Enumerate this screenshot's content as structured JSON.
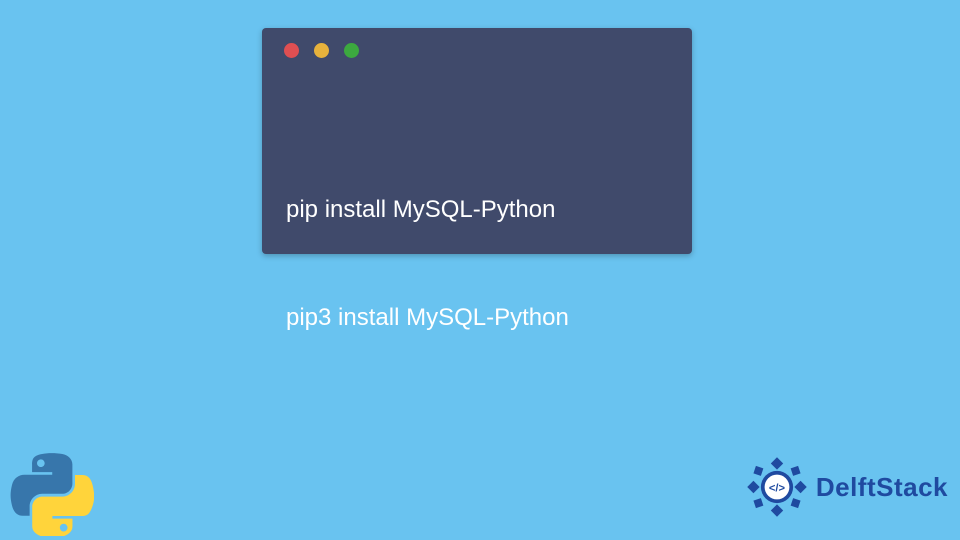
{
  "terminal": {
    "lines": [
      "pip install MySQL-Python",
      "pip3 install MySQL-Python"
    ]
  },
  "brand": {
    "name": "DelftStack"
  },
  "colors": {
    "background": "#69c3f0",
    "terminal_bg": "#404a6b",
    "terminal_fg": "#ffffff",
    "traffic_red": "#df4f52",
    "traffic_yellow": "#e7b23c",
    "traffic_green": "#3ca93f",
    "brand_color": "#1f4aa0"
  }
}
